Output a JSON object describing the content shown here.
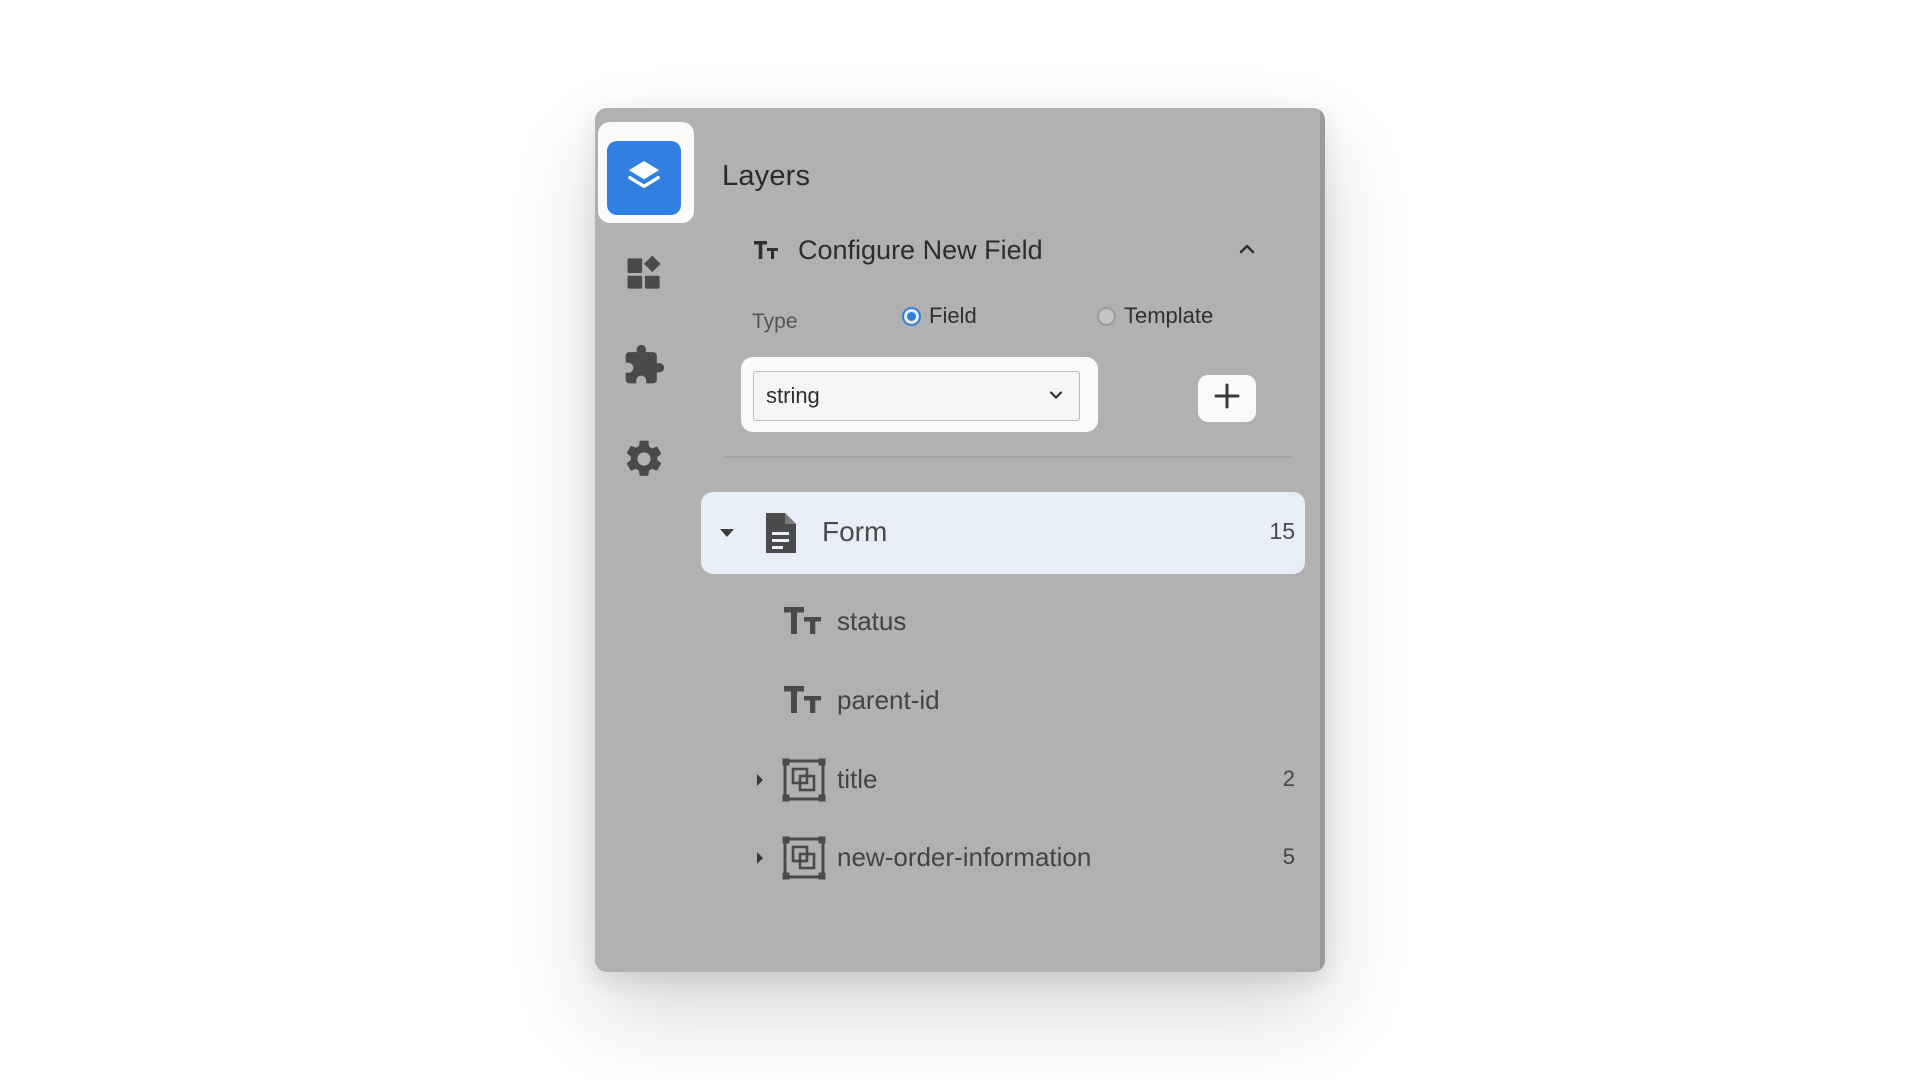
{
  "header": {
    "title": "Layers"
  },
  "sidebar": {
    "items": [
      {
        "icon": "layers-icon",
        "active": true
      },
      {
        "icon": "widgets-icon",
        "active": false
      },
      {
        "icon": "puzzle-icon",
        "active": false
      },
      {
        "icon": "gear-icon",
        "active": false
      }
    ]
  },
  "configure": {
    "title": "Configure New Field",
    "type_label": "Type",
    "options": [
      {
        "label": "Field",
        "selected": true
      },
      {
        "label": "Template",
        "selected": false
      }
    ],
    "select_value": "string"
  },
  "tree": {
    "root": {
      "label": "Form",
      "count": "15",
      "expanded": true
    },
    "items": [
      {
        "label": "status",
        "icon": "text-type-icon",
        "count": ""
      },
      {
        "label": "parent-id",
        "icon": "text-type-icon",
        "count": ""
      },
      {
        "label": "title",
        "icon": "group-icon",
        "count": "2"
      },
      {
        "label": "new-order-information",
        "icon": "group-icon",
        "count": "5"
      }
    ]
  },
  "colors": {
    "accent": "#2f80e1",
    "panel_bg": "#b1b1b1",
    "selected_row": "#e7eef8"
  }
}
